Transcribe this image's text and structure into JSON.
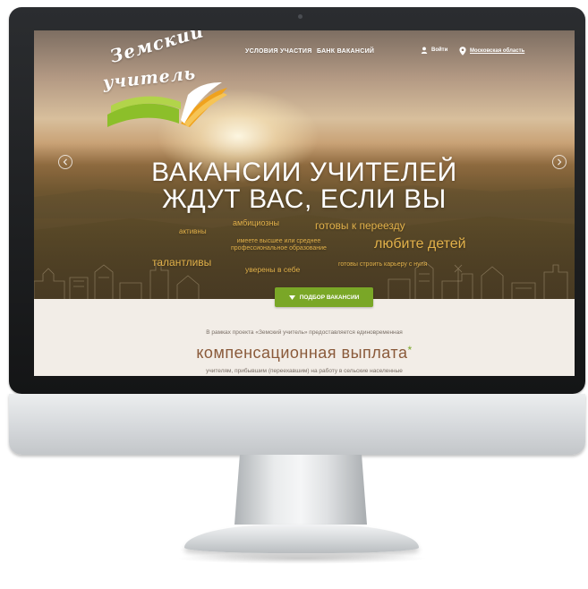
{
  "nav": {
    "conditions": "УСЛОВИЯ УЧАСТИЯ",
    "vacancies": "БАНК ВАКАНСИЙ",
    "login": "Войти",
    "region": "Московская область"
  },
  "logo": {
    "line1": "Земский",
    "line2": "учитель"
  },
  "hero": {
    "headline_line1": "ВАКАНСИИ УЧИТЕЛЕЙ",
    "headline_line2": "ЖДУТ ВАС, ЕСЛИ ВЫ",
    "traits": {
      "ambitious": "амбициозны",
      "active": "активны",
      "relocate": "готовы к переезду",
      "education_line1": "имеете высшее или среднее",
      "education_line2": "профессиональное образование",
      "children": "любите детей",
      "talented": "талантливы",
      "confident": "уверены в себе",
      "career": "готовы строить карьеру с нуля"
    },
    "cta": "ПОДБОР ВАКАНСИИ"
  },
  "content": {
    "intro": "В рамках проекта «Земский учитель» предоставляется единовременная",
    "compensation": "компенсационная выплата",
    "asterisk": "*",
    "sub": "учителям, прибывшим (переехавшим) на работу в сельские населенные"
  },
  "colors": {
    "accent_green": "#7aa727",
    "trait_gold": "#e2b14a",
    "heading_brown": "#8a5a3a"
  },
  "icons": [
    "user-icon",
    "location-pin-icon",
    "chevron-left-icon",
    "chevron-right-icon",
    "caret-down-icon",
    "book-icon"
  ]
}
